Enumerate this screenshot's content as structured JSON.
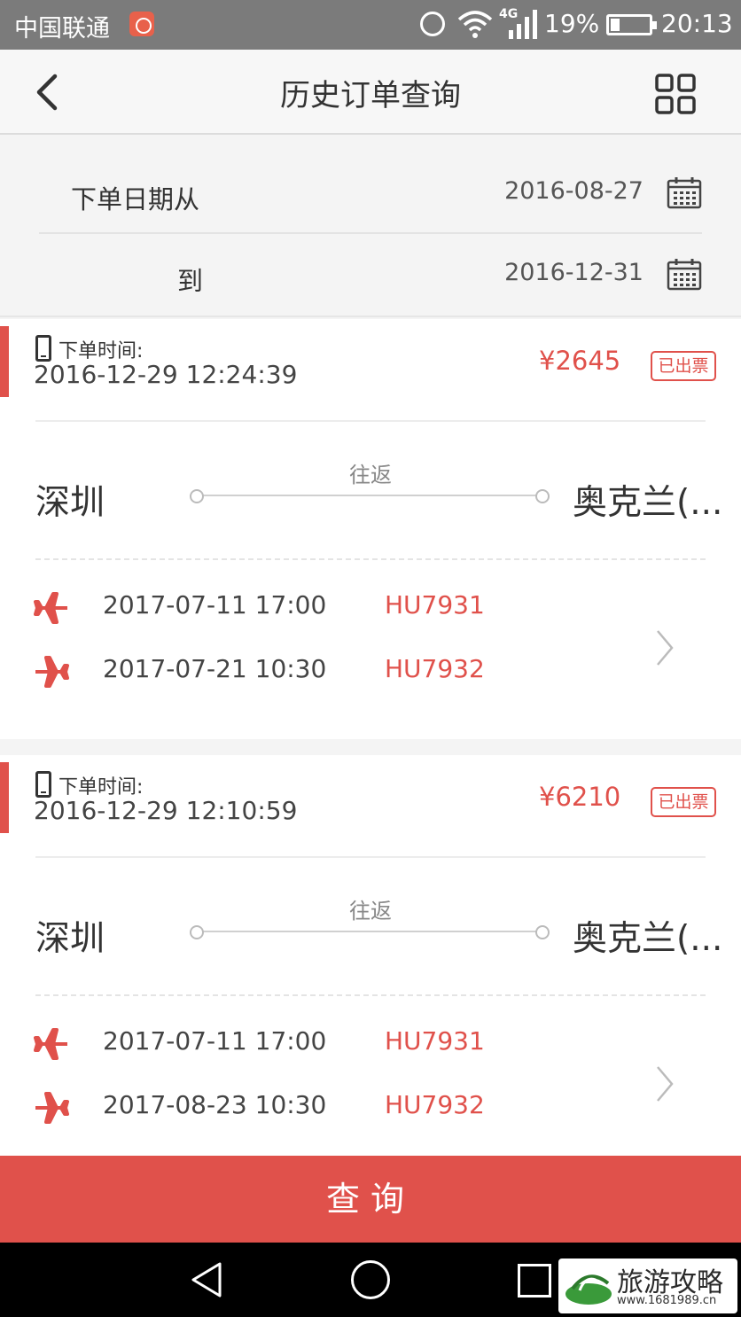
{
  "status_bar": {
    "carrier": "中国联通",
    "network": "4G",
    "battery": "19%",
    "time": "20:13"
  },
  "header": {
    "title": "历史订单查询",
    "back_icon": "chevron-left-icon",
    "menu_icon": "grid-icon"
  },
  "filter": {
    "from_label": "下单日期从",
    "from_date": "2016-08-27",
    "to_label": "到",
    "to_date": "2016-12-31"
  },
  "orders": [
    {
      "time_label": "下单时间:",
      "order_time": "2016-12-29 12:24:39",
      "price": "¥2645",
      "status": "已出票",
      "from_city": "深圳",
      "to_city": "奥克兰(...",
      "trip_type": "往返",
      "flights": [
        {
          "datetime": "2017-07-11 17:00",
          "flight_no": "HU7931"
        },
        {
          "datetime": "2017-07-21 10:30",
          "flight_no": "HU7932"
        }
      ]
    },
    {
      "time_label": "下单时间:",
      "order_time": "2016-12-29 12:10:59",
      "price": "¥6210",
      "status": "已出票",
      "from_city": "深圳",
      "to_city": "奥克兰(...",
      "trip_type": "往返",
      "flights": [
        {
          "datetime": "2017-07-11 17:00",
          "flight_no": "HU7931"
        },
        {
          "datetime": "2017-08-23 10:30",
          "flight_no": "HU7932"
        }
      ]
    }
  ],
  "query_button": "查询",
  "watermark": {
    "text": "旅游攻略",
    "url": "www.1681989.cn"
  },
  "colors": {
    "accent": "#e0514b",
    "status_bar": "#7b7b7b",
    "nav_bar": "#000000"
  }
}
